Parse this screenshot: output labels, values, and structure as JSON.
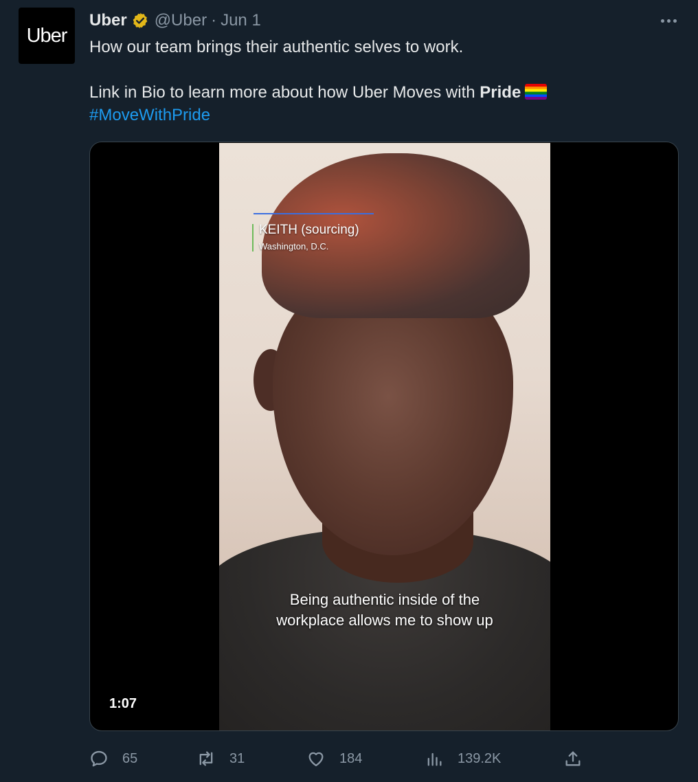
{
  "author": {
    "display_name": "Uber",
    "handle": "@Uber",
    "separator": "·",
    "date": "Jun 1",
    "avatar_text": "Uber"
  },
  "tweet": {
    "line1": "How our team brings their authentic selves to work.",
    "line2_text": "Link in Bio to learn more about how Uber Moves with ",
    "line2_bold": "Pride",
    "hashtag": "#MoveWithPride"
  },
  "video": {
    "name_tag": "KEITH (sourcing)",
    "location_tag": "Washington, D.C.",
    "caption_line1": "Being authentic inside of the",
    "caption_line2": "workplace allows me to show up",
    "duration": "1:07"
  },
  "actions": {
    "replies": "65",
    "retweets": "31",
    "likes": "184",
    "views": "139.2K"
  },
  "icons": {
    "verified": "verified-badge-icon",
    "more": "more-icon",
    "reply": "reply-icon",
    "retweet": "retweet-icon",
    "like": "heart-icon",
    "views": "views-icon",
    "share": "share-icon"
  },
  "colors": {
    "background": "#15202b",
    "link": "#1d9bf0",
    "muted": "#8b98a5",
    "verified_gold": "#e2b719"
  }
}
